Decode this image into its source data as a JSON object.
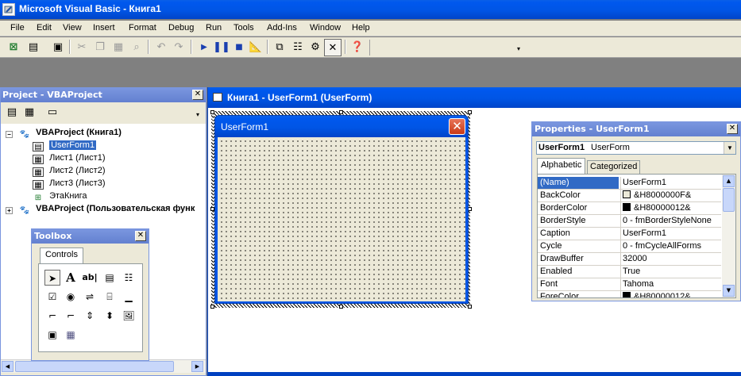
{
  "window": {
    "title": "Microsoft Visual Basic - Книга1"
  },
  "menu": [
    "File",
    "Edit",
    "View",
    "Insert",
    "Format",
    "Debug",
    "Run",
    "Tools",
    "Add-Ins",
    "Window",
    "Help"
  ],
  "project": {
    "title": "Project - VBAProject",
    "tree": [
      {
        "label": "VBAProject (Книга1)",
        "bold": true,
        "icon": "vba-project-icon"
      },
      {
        "label": "UserForm1",
        "icon": "userform-icon",
        "selected": true
      },
      {
        "label": "Лист1 (Лист1)",
        "icon": "sheet-icon"
      },
      {
        "label": "Лист2 (Лист2)",
        "icon": "sheet-icon"
      },
      {
        "label": "Лист3 (Лист3)",
        "icon": "sheet-icon"
      },
      {
        "label": "ЭтаКнига",
        "icon": "workbook-icon"
      },
      {
        "label": "VBAProject (Пользовательская функ",
        "bold": true,
        "icon": "vba-project-icon"
      }
    ]
  },
  "designer": {
    "title": "Книга1 - UserForm1 (UserForm)"
  },
  "form": {
    "title": "UserForm1"
  },
  "toolbox": {
    "title": "Toolbox",
    "tab": "Controls"
  },
  "properties": {
    "title": "Properties - UserForm1",
    "object_name": "UserForm1",
    "object_type": "UserForm",
    "tabs": [
      "Alphabetic",
      "Categorized"
    ],
    "rows": [
      {
        "key": "(Name)",
        "value": "UserForm1"
      },
      {
        "key": "BackColor",
        "value": "&H8000000F&",
        "swatch": "#ece9d8"
      },
      {
        "key": "BorderColor",
        "value": "&H80000012&",
        "swatch": "#000000"
      },
      {
        "key": "BorderStyle",
        "value": "0 - fmBorderStyleNone"
      },
      {
        "key": "Caption",
        "value": "UserForm1"
      },
      {
        "key": "Cycle",
        "value": "0 - fmCycleAllForms"
      },
      {
        "key": "DrawBuffer",
        "value": "32000"
      },
      {
        "key": "Enabled",
        "value": "True"
      },
      {
        "key": "Font",
        "value": "Tahoma"
      },
      {
        "key": "ForeColor",
        "value": "&H80000012&",
        "swatch": "#000000"
      }
    ]
  }
}
